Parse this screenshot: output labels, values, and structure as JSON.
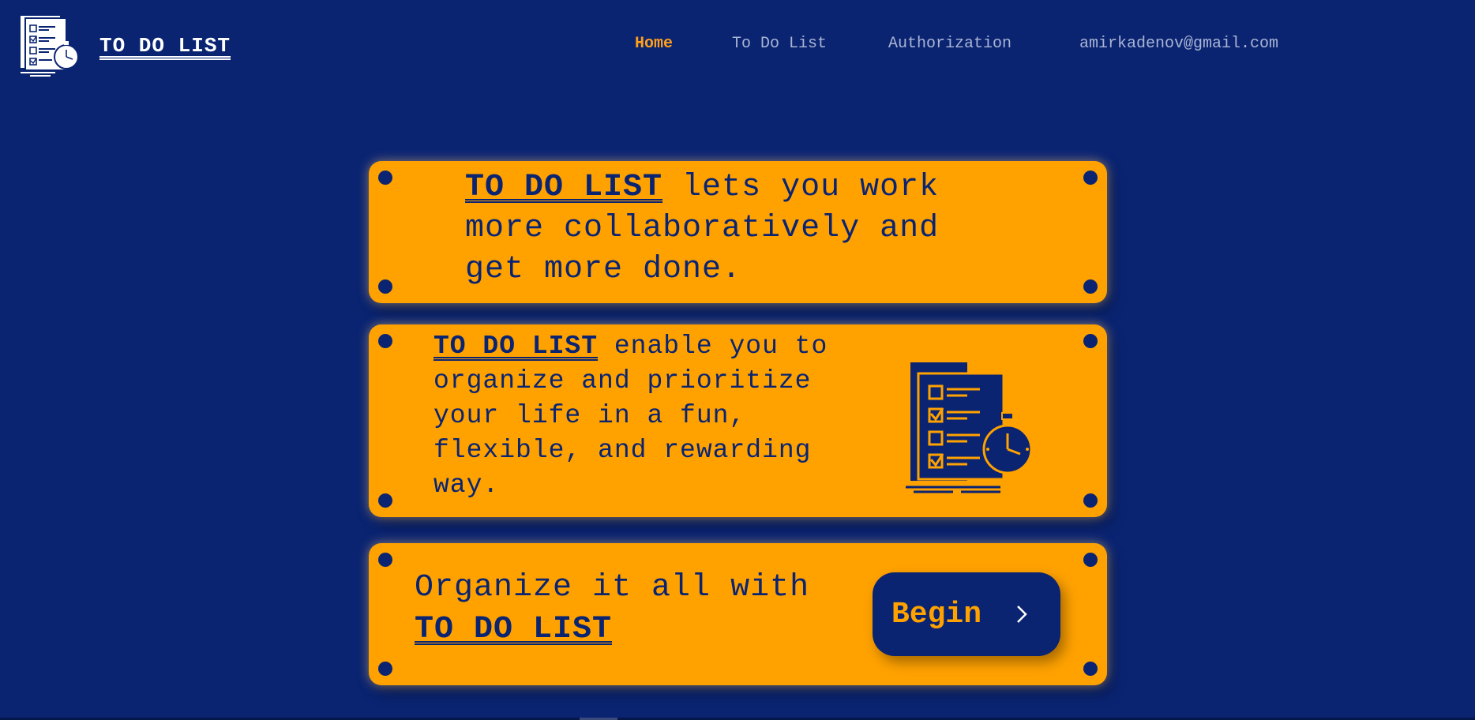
{
  "header": {
    "brand": "TO DO LIST",
    "logo_icon": "checklist-stopwatch-icon",
    "nav": {
      "home": "Home",
      "todo_list": "To Do List",
      "authorization": "Authorization",
      "email": "amirkadenov@gmail.com"
    },
    "active_nav": "Home"
  },
  "cards": {
    "card1": {
      "brand": "TO DO LIST",
      "text": " lets you work more collaboratively and get more done."
    },
    "card2": {
      "brand": "TO DO LIST",
      "text": " enable you to organize and prioritize your life in a fun, flexible, and rewarding way.",
      "illustration_icon": "checklist-stopwatch-icon"
    },
    "card3": {
      "text": "Organize it all with ",
      "brand": "TO DO LIST",
      "button_label": "Begin",
      "button_icon": "chevron-right-icon"
    }
  },
  "colors": {
    "background": "#0a2472",
    "accent": "#ffa200",
    "nav_active": "#ff9f1c",
    "nav_inactive": "#aab4d4"
  }
}
